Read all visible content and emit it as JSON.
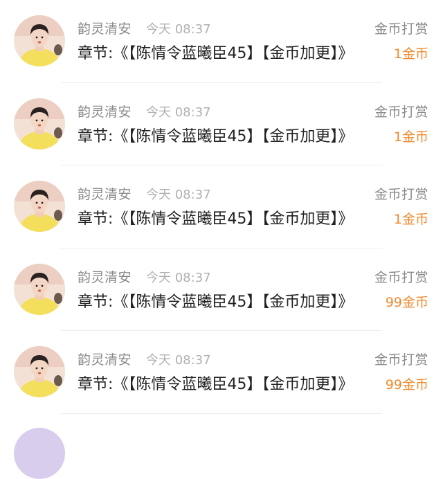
{
  "colors": {
    "amount": "#f08a2c",
    "meta": "#8a8a8a",
    "time": "#b0b0b0",
    "text": "#222222"
  },
  "rows": [
    {
      "user": "韵灵清安",
      "time": "今天 08:37",
      "type": "金币打赏",
      "chapter": "章节:《【陈情令蓝曦臣45】【金币加更】》",
      "amount": "1金币"
    },
    {
      "user": "韵灵清安",
      "time": "今天 08:37",
      "type": "金币打赏",
      "chapter": "章节:《【陈情令蓝曦臣45】【金币加更】》",
      "amount": "1金币"
    },
    {
      "user": "韵灵清安",
      "time": "今天 08:37",
      "type": "金币打赏",
      "chapter": "章节:《【陈情令蓝曦臣45】【金币加更】》",
      "amount": "1金币"
    },
    {
      "user": "韵灵清安",
      "time": "今天 08:37",
      "type": "金币打赏",
      "chapter": "章节:《【陈情令蓝曦臣45】【金币加更】》",
      "amount": "99金币"
    },
    {
      "user": "韵灵清安",
      "time": "今天 08:37",
      "type": "金币打赏",
      "chapter": "章节:《【陈情令蓝曦臣45】【金币加更】》",
      "amount": "99金币"
    }
  ]
}
